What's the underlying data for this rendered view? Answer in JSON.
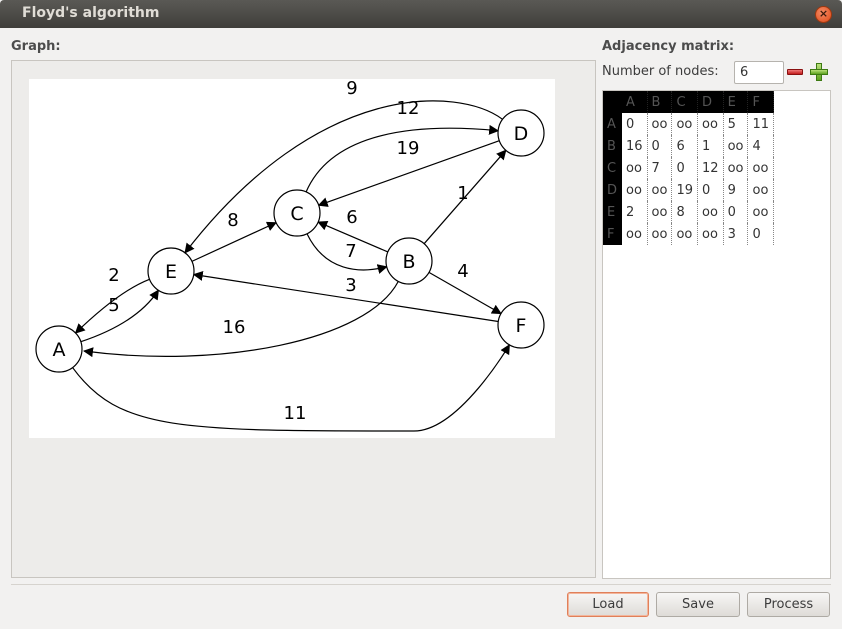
{
  "window": {
    "title": "Floyd's algorithm"
  },
  "icons": {
    "close": "close-icon",
    "remove": "minus-icon",
    "add": "plus-icon"
  },
  "graph": {
    "label": "Graph:",
    "nodes": [
      "A",
      "B",
      "C",
      "D",
      "E",
      "F"
    ],
    "edges": [
      {
        "from": "A",
        "to": "E",
        "weight": "5"
      },
      {
        "from": "A",
        "to": "F",
        "weight": "11"
      },
      {
        "from": "B",
        "to": "A",
        "weight": "16"
      },
      {
        "from": "B",
        "to": "C",
        "weight": "6"
      },
      {
        "from": "B",
        "to": "D",
        "weight": "1"
      },
      {
        "from": "B",
        "to": "F",
        "weight": "4"
      },
      {
        "from": "C",
        "to": "B",
        "weight": "7"
      },
      {
        "from": "C",
        "to": "D",
        "weight": "12"
      },
      {
        "from": "D",
        "to": "C",
        "weight": "19"
      },
      {
        "from": "D",
        "to": "E",
        "weight": "9"
      },
      {
        "from": "E",
        "to": "A",
        "weight": "2"
      },
      {
        "from": "E",
        "to": "C",
        "weight": "8"
      },
      {
        "from": "F",
        "to": "E",
        "weight": "3"
      }
    ]
  },
  "matrix": {
    "label": "Adjacency matrix:",
    "nodes_label": "Number of nodes:",
    "nodes_value": "6",
    "columns": [
      "A",
      "B",
      "C",
      "D",
      "E",
      "F"
    ],
    "rows": [
      {
        "head": "A",
        "cells": [
          "0",
          "oo",
          "oo",
          "oo",
          "5",
          "11"
        ]
      },
      {
        "head": "B",
        "cells": [
          "16",
          "0",
          "6",
          "1",
          "oo",
          "4"
        ]
      },
      {
        "head": "C",
        "cells": [
          "oo",
          "7",
          "0",
          "12",
          "oo",
          "oo"
        ]
      },
      {
        "head": "D",
        "cells": [
          "oo",
          "oo",
          "19",
          "0",
          "9",
          "oo"
        ]
      },
      {
        "head": "E",
        "cells": [
          "2",
          "oo",
          "8",
          "oo",
          "0",
          "oo"
        ]
      },
      {
        "head": "F",
        "cells": [
          "oo",
          "oo",
          "oo",
          "oo",
          "3",
          "0"
        ]
      }
    ]
  },
  "buttons": {
    "load": "Load",
    "save": "Save",
    "process": "Process"
  }
}
